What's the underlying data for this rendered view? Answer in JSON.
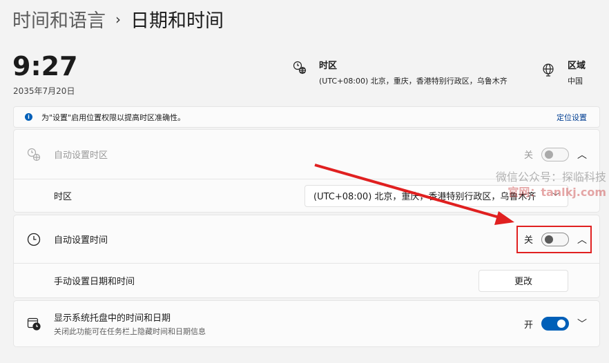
{
  "breadcrumb": {
    "parent": "时间和语言",
    "separator": "›",
    "current": "日期和时间"
  },
  "clock": {
    "time": "9:27",
    "date": "2035年7月20日"
  },
  "timezone_summary": {
    "title": "时区",
    "value": "(UTC+08:00) 北京，重庆，香港特别行政区，乌鲁木齐"
  },
  "region_summary": {
    "title": "区域",
    "value": "中国"
  },
  "info_bar": {
    "text": "为\"设置\"启用位置权限以提高时区准确性。",
    "link": "定位设置"
  },
  "auto_timezone": {
    "label": "自动设置时区",
    "state": "关",
    "enabled": false
  },
  "timezone_row": {
    "label": "时区",
    "value": "(UTC+08:00) 北京，重庆，香港特别行政区，乌鲁木齐"
  },
  "auto_time": {
    "label": "自动设置时间",
    "state": "关"
  },
  "manual_time": {
    "label": "手动设置日期和时间",
    "button": "更改"
  },
  "tray": {
    "label": "显示系统托盘中的时间和日期",
    "sub": "关闭此功能可在任务栏上隐藏时间和日期信息",
    "state": "开"
  },
  "watermark": {
    "line1": "微信公众号：探临科技",
    "line2": "官网：tanlkj.com"
  },
  "colors": {
    "accent": "#005fb8",
    "annotation": "#e02020"
  }
}
